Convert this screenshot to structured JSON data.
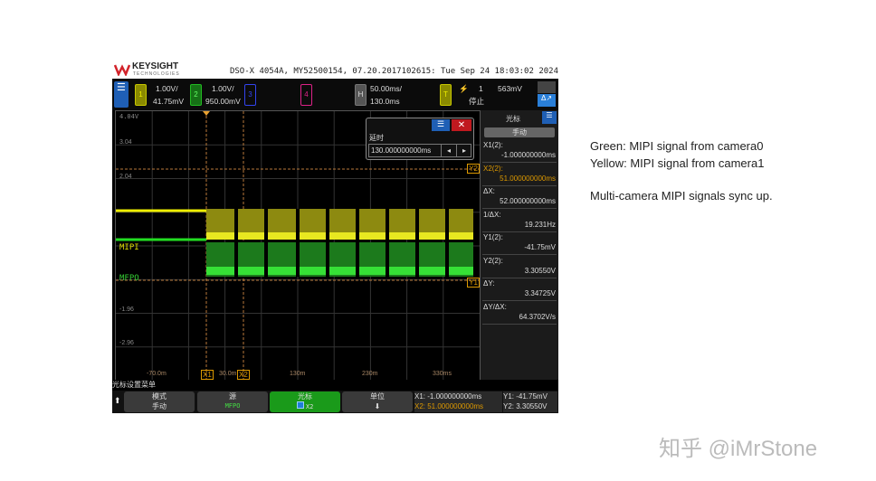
{
  "logo": {
    "brand": "KEYSIGHT",
    "sub": "TECHNOLOGIES"
  },
  "scope_info": "DSO-X 4054A, MY52500154, 07.20.2017102615: Tue Sep 24 18:03:02 2024",
  "channels": [
    {
      "num": "1",
      "scale": "1.00V/",
      "offset": "41.75mV",
      "color": "#c8c800"
    },
    {
      "num": "2",
      "scale": "1.00V/",
      "offset": "950.00mV",
      "color": "#22bb22"
    },
    {
      "num": "3",
      "color": "#3344ee"
    },
    {
      "num": "4",
      "color": "#dd2288"
    }
  ],
  "horizontal": {
    "label": "H",
    "scale": "50.00ms/",
    "delay": "130.0ms"
  },
  "trigger": {
    "label": "T",
    "source": "1",
    "level": "563mV",
    "status": "停止"
  },
  "delay_dialog": {
    "label": "延时",
    "value": "130.000000000ms"
  },
  "grid_labels": {
    "y": [
      "4.04V",
      "3.04",
      "2.04",
      "-1.96",
      "-2.96"
    ],
    "x": [
      "-70.0m",
      "30.0m",
      "130m",
      "230m",
      "330ms"
    ],
    "ch_labels": [
      "MIPI",
      "MFPO"
    ],
    "cursors": [
      "X1",
      "X2",
      "Y1",
      "Y2"
    ]
  },
  "cursor_panel": {
    "title": "光标",
    "mode": "手动",
    "items": [
      {
        "label": "X1(2):",
        "value": "-1.000000000ms"
      },
      {
        "label": "X2(2):",
        "value": "51.000000000ms",
        "highlight": true
      },
      {
        "label": "ΔX:",
        "value": "52.000000000ms"
      },
      {
        "label": "1/ΔX:",
        "value": "19.231Hz"
      },
      {
        "label": "Y1(2):",
        "value": "-41.75mV"
      },
      {
        "label": "Y2(2):",
        "value": "3.30550V"
      },
      {
        "label": "ΔY:",
        "value": "3.34725V"
      },
      {
        "label": "ΔY/ΔX:",
        "value": "64.3702V/s"
      }
    ]
  },
  "menu_title": "光标设置菜单",
  "softkeys": [
    {
      "top": "模式",
      "bottom": "手动"
    },
    {
      "top": "源",
      "bottom": "MFPO"
    },
    {
      "top": "光标",
      "bottom": "X2"
    },
    {
      "top": "单位",
      "bottom": ""
    }
  ],
  "readout": {
    "x1": "X1: -1.000000000ms",
    "x2": "X2: 51.000000000ms",
    "y1": "Y1: -41.75mV",
    "y2": "Y2: 3.30550V"
  },
  "notes": [
    "Green: MIPI signal from camera0",
    "Yellow: MIPI signal from camera1",
    "Multi-camera MIPI signals sync up."
  ],
  "watermark": "知乎 @iMrStone"
}
